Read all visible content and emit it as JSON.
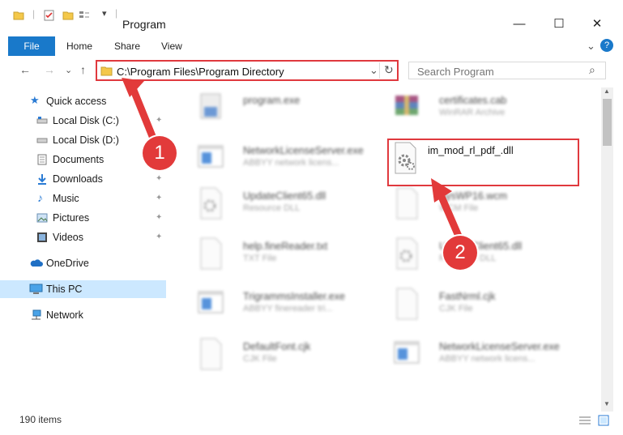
{
  "window": {
    "title": "Program",
    "min_glyph": "—",
    "max_glyph": "☐",
    "close_glyph": "✕"
  },
  "ribbon": {
    "tabs": [
      "File",
      "Home",
      "Share",
      "View"
    ],
    "expand_glyph": "⌄",
    "help_glyph": "?"
  },
  "nav": {
    "back": "←",
    "forward": "→",
    "recent": "⌄",
    "up": "↑"
  },
  "address": {
    "path": "C:\\Program Files\\Program Directory",
    "dropdown": "⌄",
    "refresh": "↻"
  },
  "search": {
    "placeholder": "Search Program",
    "icon_glyph": "⌕"
  },
  "sidebar": {
    "items": [
      {
        "label": "Quick access",
        "icon": "star-icon",
        "pinned": false
      },
      {
        "label": "Local Disk (C:)",
        "icon": "drive-icon",
        "pinned": true
      },
      {
        "label": "Local Disk (D:)",
        "icon": "drive-icon",
        "pinned": false
      },
      {
        "label": "Documents",
        "icon": "documents-icon",
        "pinned": true
      },
      {
        "label": "Downloads",
        "icon": "downloads-icon",
        "pinned": true
      },
      {
        "label": "Music",
        "icon": "music-icon",
        "pinned": true
      },
      {
        "label": "Pictures",
        "icon": "pictures-icon",
        "pinned": true
      },
      {
        "label": "Videos",
        "icon": "videos-icon",
        "pinned": true
      },
      {
        "label": "OneDrive",
        "icon": "cloud-icon",
        "pinned": false
      },
      {
        "label": "This PC",
        "icon": "computer-icon",
        "pinned": false,
        "selected": true
      },
      {
        "label": "Network",
        "icon": "network-icon",
        "pinned": false
      }
    ],
    "pin_glyph": "📌"
  },
  "files": [
    {
      "name": "program.exe",
      "type": "",
      "icon": "installer-icon",
      "blurred": true
    },
    {
      "name": "certificates.cab",
      "type": "WinRAR Archive",
      "icon": "archive-icon",
      "blurred": true
    },
    {
      "name": "NetworkLicenseServer.exe",
      "type": "ABBYY network licens...",
      "icon": "app-window-icon",
      "blurred": true
    },
    {
      "name": "im_mod_rl_pdf_.dll",
      "type": "",
      "icon": "dll-gear-icon",
      "blurred": false
    },
    {
      "name": "UpdateClient65.dll",
      "type": "Resource DLL",
      "icon": "dll-gear-icon",
      "blurred": true
    },
    {
      "name": "SysWP16.wcm",
      "type": "WCM File",
      "icon": "blank-file-icon",
      "blurred": true
    },
    {
      "name": "help.fineReader.txt",
      "type": "TXT File",
      "icon": "blank-file-icon",
      "blurred": true
    },
    {
      "name": "UpdateClient65.dll",
      "type": "Resource DLL",
      "icon": "dll-gear-icon",
      "blurred": true
    },
    {
      "name": "TrigrammsInstaller.exe",
      "type": "ABBYY finereader tri...",
      "icon": "app-window-icon",
      "blurred": true
    },
    {
      "name": "FastNrml.cjk",
      "type": "CJK File",
      "icon": "blank-file-icon",
      "blurred": true
    },
    {
      "name": "DefaultFont.cjk",
      "type": "CJK File",
      "icon": "blank-file-icon",
      "blurred": true
    },
    {
      "name": "NetworkLicenseServer.exe",
      "type": "ABBYY network licens...",
      "icon": "app-window-icon",
      "blurred": true
    }
  ],
  "status": {
    "count": "190 items"
  },
  "annotations": {
    "step1": "1",
    "step2": "2",
    "color": "#e23a3a"
  },
  "colors": {
    "accent": "#1979ca",
    "highlight_border": "#e0393e",
    "selected_bg": "#e5f3ff"
  }
}
